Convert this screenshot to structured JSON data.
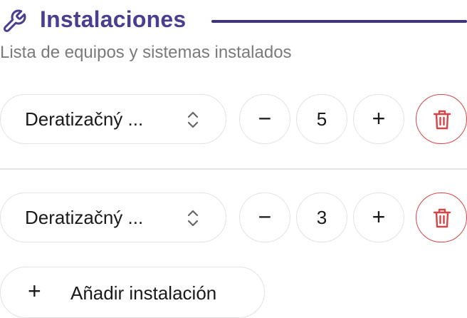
{
  "header": {
    "icon": "wrench-icon",
    "title": "Instalaciones",
    "subtitle": "Lista de equipos y sistemas instalados",
    "accent_color": "#4a3f8f"
  },
  "installations": [
    {
      "equipment": "Deratizačný ...",
      "quantity": "5"
    },
    {
      "equipment": "Deratizačný ...",
      "quantity": "3"
    }
  ],
  "controls": {
    "decrement_symbol": "−",
    "increment_symbol": "+",
    "delete_icon": "trash-icon",
    "delete_color": "#d64545"
  },
  "add_button": {
    "symbol": "+",
    "label": "Añadir instalación"
  }
}
